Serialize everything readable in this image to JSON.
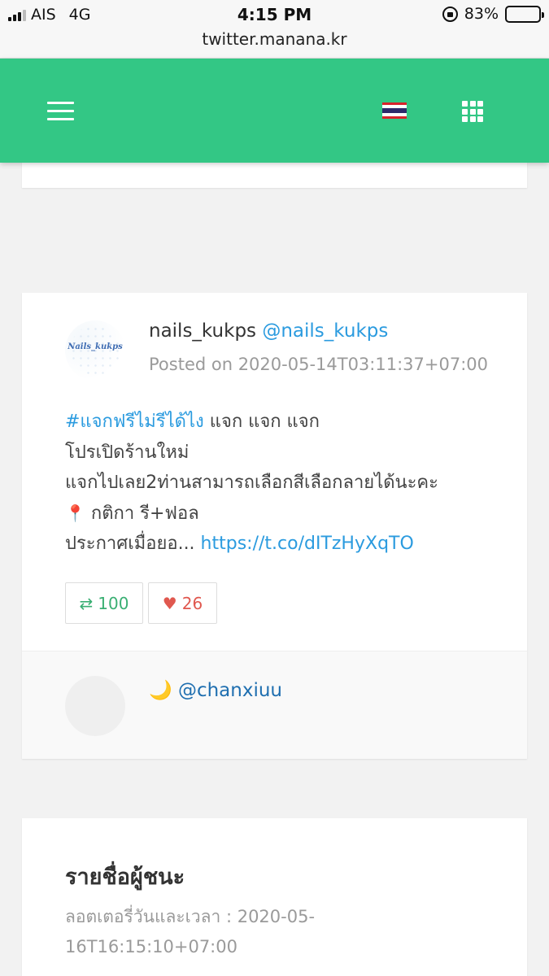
{
  "status_bar": {
    "carrier": "AIS",
    "network": "4G",
    "time": "4:15 PM",
    "battery": "83%",
    "battery_level": 0.83,
    "url": "twitter.manana.kr"
  },
  "header": {
    "menu_icon": "hamburger-menu-icon",
    "flag_icon": "thailand-flag-icon",
    "apps_icon": "grid-apps-icon",
    "color": "#33c785"
  },
  "post": {
    "display_name": "nails_kukps",
    "handle": "@nails_kukps",
    "avatar_text": "Nails_kukps",
    "posted": "Posted on 2020-05-14T03:11:37+07:00",
    "hashtag": "#แจกฟรีไม่รีได้ไง",
    "line1_rest": " แจก แจก แจก",
    "line2": "โปรเปิดร้านใหม่",
    "line3": "แจกไปเลย2ท่านสามารถเลือกสีเลือกลายได้นะคะ",
    "pin_icon": "📍",
    "line4": " กติกา รี+ฟอล",
    "line5_prefix": "ประกาศเมื่อยอ... ",
    "link": "https://t.co/dITzHyXqTO",
    "retweets": "100",
    "likes": "26",
    "retweet_icon": "⇄",
    "heart_icon": "♥"
  },
  "reply": {
    "emoji": "🌙",
    "user": "@chanxiuu"
  },
  "winners": {
    "title": "รายชื่อผู้ชนะ",
    "subtitle": "ลอตเตอรี่วันและเวลา : 2020-05-16T16:15:10+07:00"
  }
}
